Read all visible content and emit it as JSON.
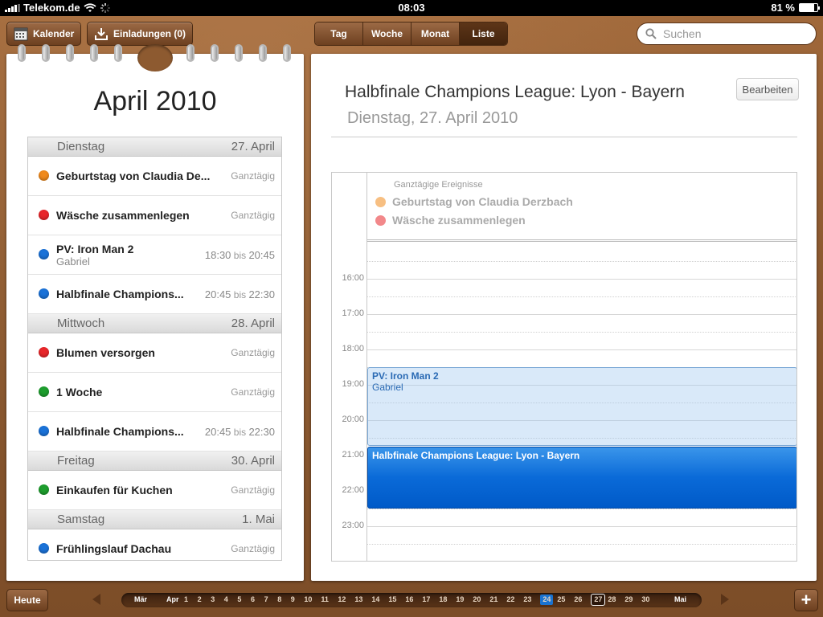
{
  "statusbar": {
    "carrier": "Telekom.de",
    "time": "08:03",
    "battery": "81 %",
    "battery_level": 0.81
  },
  "toolbar": {
    "calendars_label": "Kalender",
    "invitations_label": "Einladungen (0)",
    "views": [
      "Tag",
      "Woche",
      "Monat",
      "Liste"
    ],
    "active_view": "Liste",
    "search_placeholder": "Suchen"
  },
  "list": {
    "month_title": "April 2010",
    "days": [
      {
        "weekday": "Dienstag",
        "date": "27. April",
        "events": [
          {
            "title": "Geburtstag von Claudia De...",
            "time": "Ganztägig",
            "color": "#f08a1c"
          },
          {
            "title": "Wäsche zusammenlegen",
            "time": "Ganztägig",
            "color": "#e8262a"
          },
          {
            "title": "PV: Iron Man 2",
            "sub": "Gabriel",
            "start": "18:30",
            "to": "bis",
            "end": "20:45",
            "color": "#1a72d8"
          },
          {
            "title": "Halbfinale Champions...",
            "start": "20:45",
            "to": "bis",
            "end": "22:30",
            "color": "#1a72d8"
          }
        ]
      },
      {
        "weekday": "Mittwoch",
        "date": "28. April",
        "events": [
          {
            "title": "Blumen versorgen",
            "time": "Ganztägig",
            "color": "#e8262a"
          },
          {
            "title": "1 Woche",
            "time": "Ganztägig",
            "color": "#1e9e2e"
          },
          {
            "title": "Halbfinale Champions...",
            "start": "20:45",
            "to": "bis",
            "end": "22:30",
            "color": "#1a72d8"
          }
        ]
      },
      {
        "weekday": "Freitag",
        "date": "30. April",
        "events": [
          {
            "title": "Einkaufen für Kuchen",
            "time": "Ganztägig",
            "color": "#1e9e2e"
          }
        ]
      },
      {
        "weekday": "Samstag",
        "date": "1. Mai",
        "events": [
          {
            "title": "Frühlingslauf Dachau",
            "time": "Ganztägig",
            "color": "#1a72d8"
          }
        ]
      }
    ]
  },
  "detail": {
    "title": "Halbfinale Champions League: Lyon - Bayern",
    "date": "Dienstag, 27. April 2010",
    "edit_label": "Bearbeiten",
    "allday_label": "Ganztägige Ereignisse",
    "allday_events": [
      {
        "title": "Geburtstag von Claudia Derzbach",
        "color": "#f08a1c"
      },
      {
        "title": "Wäsche zusammenlegen",
        "color": "#e8262a"
      }
    ],
    "hours": [
      "16:00",
      "17:00",
      "18:00",
      "19:00",
      "20:00",
      "21:00",
      "22:00",
      "23:00"
    ],
    "timed_events": [
      {
        "title": "PV: Iron Man 2",
        "sub": "Gabriel",
        "style": "light"
      },
      {
        "title": "Halbfinale Champions League: Lyon - Bayern",
        "style": "dark"
      }
    ]
  },
  "bottombar": {
    "today_label": "Heute",
    "add_label": "+",
    "strip": [
      "Mär",
      "Apr",
      "1",
      "2",
      "3",
      "4",
      "5",
      "6",
      "7",
      "8",
      "9",
      "10",
      "11",
      "12",
      "13",
      "14",
      "15",
      "16",
      "17",
      "18",
      "19",
      "20",
      "21",
      "22",
      "23",
      "24",
      "25",
      "26",
      "27",
      "28",
      "29",
      "30",
      "Mai"
    ],
    "today": "24",
    "selected": "27"
  }
}
